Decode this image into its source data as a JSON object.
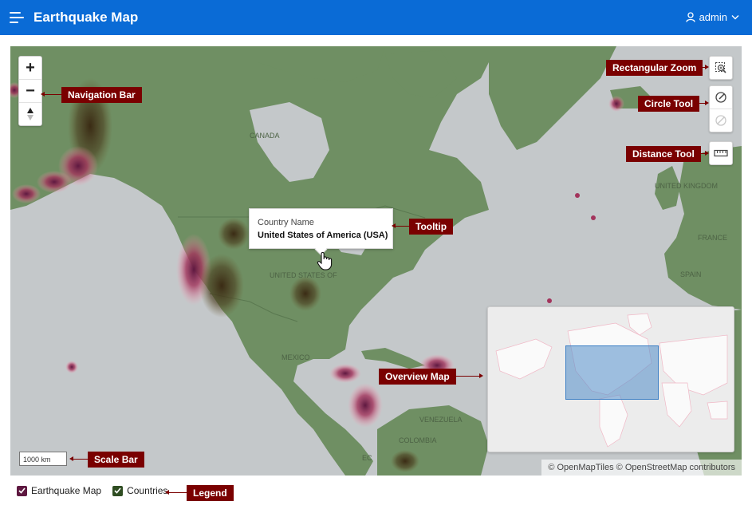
{
  "header": {
    "title": "Earthquake Map",
    "user": "admin",
    "brand_color": "#0a6bd6"
  },
  "map": {
    "zoom_in_label": "+",
    "zoom_out_label": "−",
    "tooltip": {
      "label": "Country Name",
      "value": "United States of America (USA)"
    },
    "scale_label": "1000 km",
    "attribution": "© OpenMapTiles  © OpenStreetMap contributors",
    "place_labels": [
      "CANADA",
      "UNITED STATES OF",
      "MEXICO",
      "VENEZUELA",
      "COLOMBIA",
      "EC",
      "UNITED KINGDOM",
      "FRANCE",
      "SPAIN"
    ]
  },
  "callouts": {
    "navigation_bar": "Navigation Bar",
    "rectangular_zoom": "Rectangular Zoom",
    "circle_tool": "Circle Tool",
    "distance_tool": "Distance Tool",
    "tooltip": "Tooltip",
    "overview_map": "Overview Map",
    "scale_bar": "Scale Bar",
    "legend": "Legend"
  },
  "legend": {
    "items": [
      {
        "label": "Earthquake Map",
        "color": "#5e1840"
      },
      {
        "label": "Countries",
        "color": "#2f4d22"
      }
    ]
  },
  "icons": [
    "menu-icon",
    "user-icon",
    "chevron-down-icon",
    "zoom-in-icon",
    "zoom-out-icon",
    "compass-icon",
    "rectangle-zoom-icon",
    "circle-tool-icon",
    "clear-icon",
    "ruler-icon",
    "pointer-hand-icon",
    "checkbox-icon"
  ]
}
